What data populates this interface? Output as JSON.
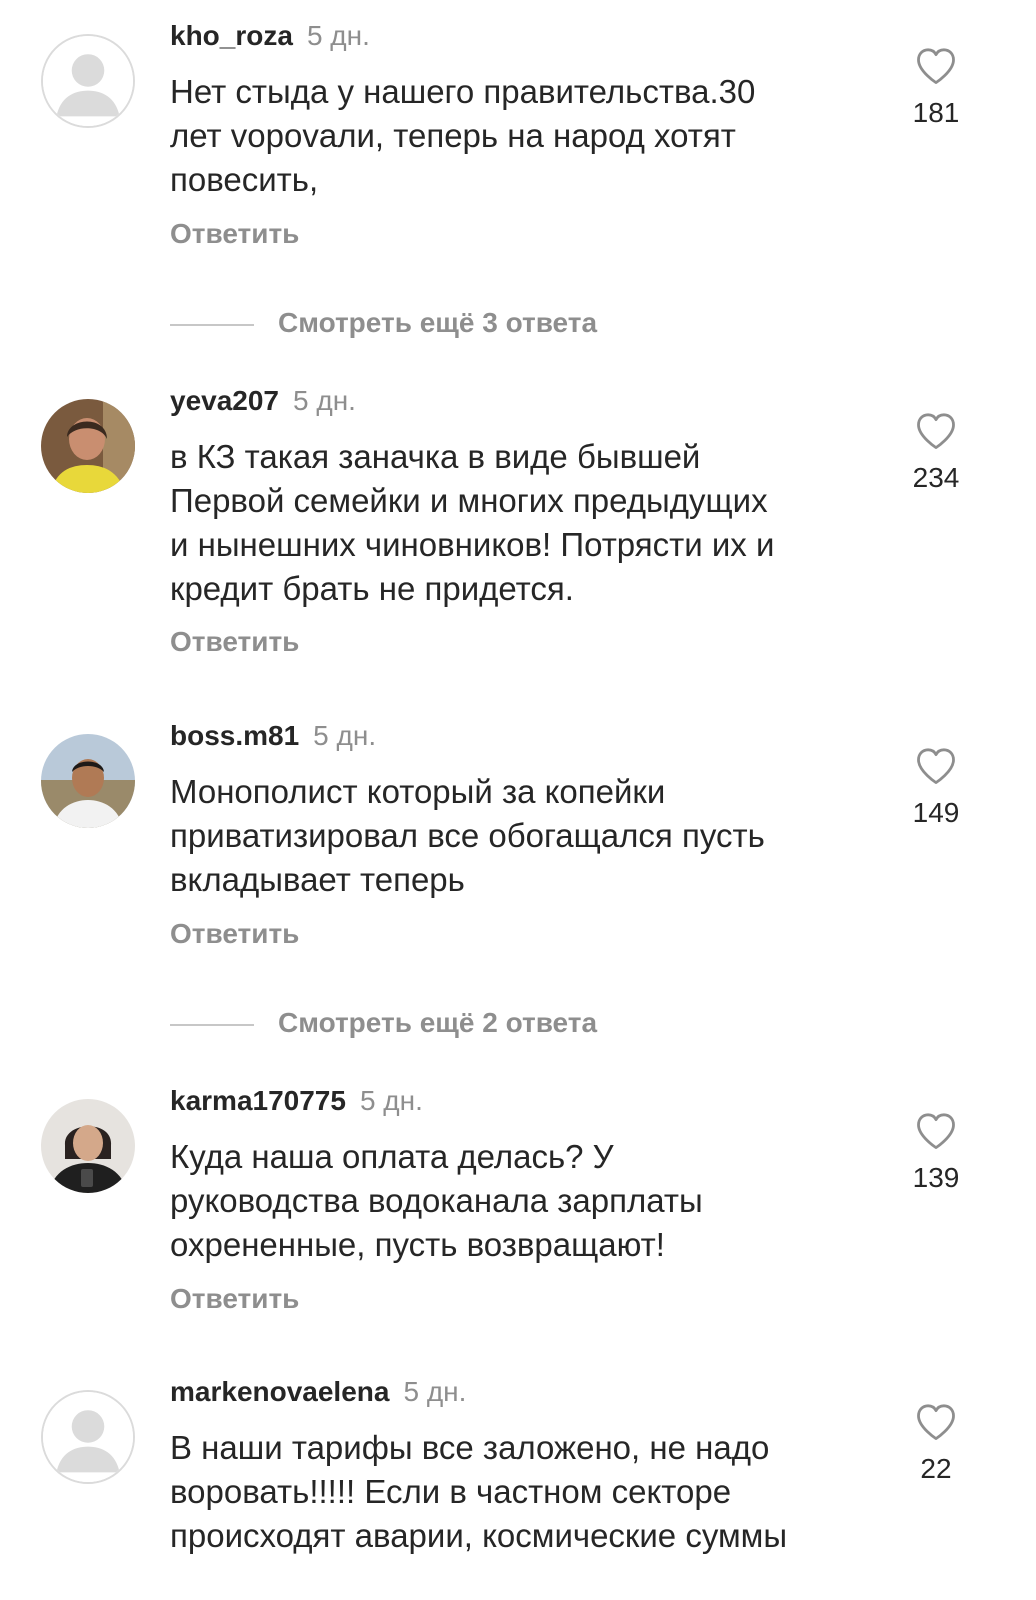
{
  "comments": [
    {
      "username": "kho_roza",
      "time": "5 дн.",
      "text": "Нет стыда у нашего правительства.30\nлет vороvали, теперь на народ хотят\nповесить,",
      "reply": "Ответить",
      "likes": "181",
      "avatar": "default-avatar"
    },
    {
      "username": "yeva207",
      "time": "5 дн.",
      "text": "в КЗ такая заначка в виде бывшей\nПервой семейки и многих предыдущих\nи нынешних чиновников! Потрясти их и\nкредит брать не придется.",
      "reply": "Ответить",
      "likes": "234",
      "avatar": "user-photo"
    },
    {
      "username": "boss.m81",
      "time": "5 дн.",
      "text": "Монополист который за копейки\nприватизировал все обогащался пусть\nвкладывает теперь",
      "reply": "Ответить",
      "likes": "149",
      "avatar": "user-photo"
    },
    {
      "username": "karma170775",
      "time": "5 дн.",
      "text": "Куда наша оплата делась? У\nруководства водоканала зарплаты\nохрененные, пусть возвращают!",
      "reply": "Ответить",
      "likes": "139",
      "avatar": "user-photo"
    },
    {
      "username": "markenovaelena",
      "time": "5 дн.",
      "text": "В наши тарифы все заложено, не надо\nворовать!!!!! Если в частном секторе\nпроисходят аварии, космические суммы",
      "reply": "",
      "likes": "22",
      "avatar": "default-avatar"
    }
  ],
  "view_more": [
    {
      "label": "Смотреть ещё 3 ответа"
    },
    {
      "label": "Смотреть ещё 2 ответа"
    }
  ],
  "icons": {
    "like": "heart-outline-icon"
  },
  "colors": {
    "text": "#262626",
    "secondary": "#8e8e8e",
    "divider": "#c7c7c7",
    "background": "#ffffff"
  }
}
